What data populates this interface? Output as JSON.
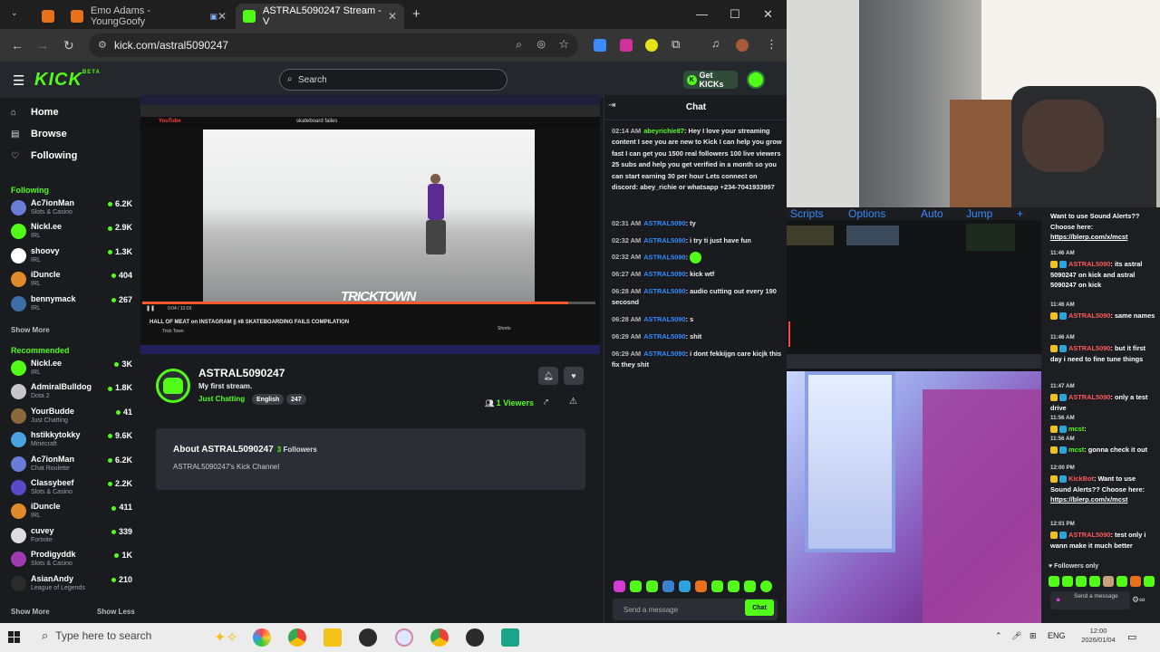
{
  "browser": {
    "tabs": [
      {
        "title": "Emo Adams - YoungGoofy",
        "active": false
      },
      {
        "title": "ASTRAL5090247 Stream - V",
        "active": true
      }
    ],
    "new_tab": "+",
    "url": "kick.com/astral5090247",
    "controls": {
      "minimize": "—",
      "maximize": "☐",
      "close": "✕"
    }
  },
  "kick": {
    "logo": "KICK",
    "logo_sup": "BETA",
    "search_placeholder": "Search",
    "get_kicks": "Get KICKs",
    "nav": [
      {
        "label": "Home",
        "icon": "⌂"
      },
      {
        "label": "Browse",
        "icon": "▤"
      },
      {
        "label": "Following",
        "icon": "♡"
      }
    ],
    "following_title": "Following",
    "following": [
      {
        "name": "Ac7ionMan",
        "category": "Slots & Casino",
        "viewers": "6.2K",
        "color": "#6a7bd8"
      },
      {
        "name": "Nickl.ee",
        "category": "IRL",
        "viewers": "2.9K",
        "color": "#53fc18"
      },
      {
        "name": "shoovy",
        "category": "IRL",
        "viewers": "1.3K",
        "color": "#ffffff"
      },
      {
        "name": "iDuncle",
        "category": "IRL",
        "viewers": "404",
        "color": "#e08a2a"
      },
      {
        "name": "bennymack",
        "category": "IRL",
        "viewers": "267",
        "color": "#3a6ea5"
      }
    ],
    "show_more_1": "Show More",
    "recommended_title": "Recommended",
    "recommended": [
      {
        "name": "Nickl.ee",
        "category": "IRL",
        "viewers": "3K",
        "color": "#53fc18"
      },
      {
        "name": "AdmiralBulldog",
        "category": "Dota 2",
        "viewers": "1.8K",
        "color": "#c6c6c6"
      },
      {
        "name": "YourBudde",
        "category": "Just Chatting",
        "viewers": "41",
        "color": "#8a6a3a"
      },
      {
        "name": "hstikkytokky",
        "category": "Minecraft",
        "viewers": "9.6K",
        "color": "#4aa3df"
      },
      {
        "name": "Ac7ionMan",
        "category": "Chat Roulette",
        "viewers": "6.2K",
        "color": "#6a7bd8"
      },
      {
        "name": "Classybeef",
        "category": "Slots & Casino",
        "viewers": "2.2K",
        "color": "#5a4ac8"
      },
      {
        "name": "iDuncle",
        "category": "IRL",
        "viewers": "411",
        "color": "#e08a2a"
      },
      {
        "name": "cuvey",
        "category": "Fortnite",
        "viewers": "339",
        "color": "#dddddd"
      },
      {
        "name": "Prodigyddk",
        "category": "Slots & Casino",
        "viewers": "1K",
        "color": "#a03ab0"
      },
      {
        "name": "AsianAndy",
        "category": "League of Legends",
        "viewers": "210",
        "color": "#2b2b2b"
      }
    ],
    "show_more_2": "Show More",
    "show_less": "Show Less",
    "player": {
      "yt_logo": "YouTube",
      "yt_search": "skateboard failes",
      "watermark": "TRICKTOWN",
      "time": "0:04 / 10:03",
      "progress": 0.94,
      "video_title": "HALL OF MEAT on INSTAGRAM || #8 SKATEBOARDING FAILS COMPILATION",
      "channel": "Trick Town",
      "shorts": "Shorts"
    },
    "streamer": {
      "name": "ASTRAL5090247",
      "title": "My first stream.",
      "category": "Just Chatting",
      "tags": [
        "English",
        "247"
      ],
      "viewers": "1",
      "viewers_label": "Viewers"
    },
    "about": {
      "title": "About ASTRAL5090247",
      "followers_count": "3",
      "followers_label": "Followers",
      "desc": "ASTRAL5090247's Kick Channel"
    },
    "chat": {
      "title": "Chat",
      "messages": [
        {
          "time": "02:14 AM",
          "user": "abeyrichie87",
          "text": "Hey I love your streaming content I see you are new to Kick I can help you grow fast I can get you 1500 real followers 100 live viewers 25 subs and help you get verified in a month so you can start earning 30 per hour Lets connect on discord: abey_richie or whatsapp +234-7041933997"
        },
        {
          "time": "02:31 AM",
          "user": "ASTRAL5090",
          "text": "ty"
        },
        {
          "time": "02:32 AM",
          "user": "ASTRAL5090",
          "text": "i try ti just have fun"
        },
        {
          "time": "02:32 AM",
          "user": "ASTRAL5090",
          "text": ""
        },
        {
          "time": "06:27 AM",
          "user": "ASTRAL5090",
          "text": "kick wtf"
        },
        {
          "time": "06:28 AM",
          "user": "ASTRAL5090",
          "text": "audio cutting out every 190 secosnd"
        },
        {
          "time": "06:28 AM",
          "user": "ASTRAL5090",
          "text": "s"
        },
        {
          "time": "06:29 AM",
          "user": "ASTRAL5090",
          "text": "shit"
        },
        {
          "time": "06:29 AM",
          "user": "ASTRAL5090",
          "text": "i dont fekkijgn care kicjk this fix they shit"
        }
      ],
      "input_placeholder": "Send a message",
      "send_label": "Chat"
    }
  },
  "obs_menu": [
    "Scripts",
    "Options",
    "Auto",
    "Jump",
    "+"
  ],
  "chat_overlay": {
    "items": [
      {
        "time": "",
        "user": "",
        "text": "Want to use Sound Alerts?? Choose here:",
        "link": "https://blerp.com/x/mcst"
      },
      {
        "time": "11:46 AM",
        "user": "ASTRAL5090",
        "text": "its astral 5090247 on kick and astral 5090247 on kick",
        "link": ""
      },
      {
        "time": "11:46 AM",
        "user": "ASTRAL5090",
        "text": "same names",
        "link": ""
      },
      {
        "time": "11:46 AM",
        "user": "ASTRAL5090",
        "text": "but it first day i need to fine tune things",
        "link": ""
      },
      {
        "time": "11:47 AM",
        "user": "ASTRAL5090",
        "text": "only a test drive",
        "link": ""
      },
      {
        "time": "11:56 AM",
        "user": "mcst",
        "text": "",
        "link": ""
      },
      {
        "time": "11:56 AM",
        "user": "mcst",
        "text": "gonna check it out",
        "link": ""
      },
      {
        "time": "12:00 PM",
        "user": "KickBot",
        "text": "Want to use Sound Alerts?? Choose here:",
        "link": "https://blerp.com/x/mcst"
      },
      {
        "time": "12:01 PM",
        "user": "ASTRAL5090",
        "text": "test only i wann make it much better",
        "link": ""
      }
    ],
    "followers_only": "Followers only",
    "input_placeholder": "Send a message"
  },
  "taskbar": {
    "search_placeholder": "Type here to search",
    "lang": "ENG",
    "time": "12:00",
    "date": "2026/01/04"
  }
}
